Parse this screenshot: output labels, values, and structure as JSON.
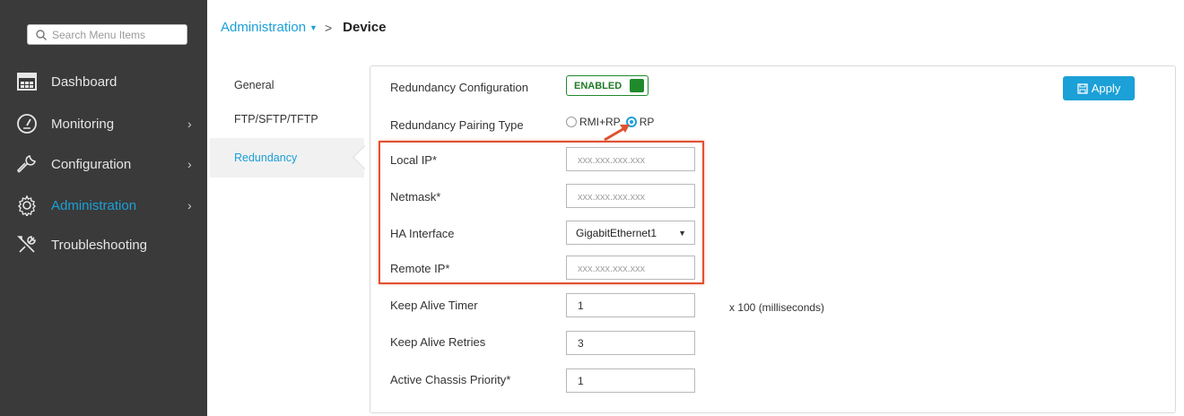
{
  "search": {
    "placeholder": "Search Menu Items"
  },
  "sidebar": {
    "items": [
      {
        "label": "Dashboard",
        "icon": "dashboard-icon",
        "chevron": ""
      },
      {
        "label": "Monitoring",
        "icon": "gauge-icon",
        "chevron": "›"
      },
      {
        "label": "Configuration",
        "icon": "wrench-icon",
        "chevron": "›"
      },
      {
        "label": "Administration",
        "icon": "gear-icon",
        "chevron": "›"
      },
      {
        "label": "Troubleshooting",
        "icon": "tools-icon",
        "chevron": ""
      }
    ]
  },
  "breadcrumb": {
    "parent": "Administration",
    "separator": ">",
    "current": "Device"
  },
  "submenu": {
    "items": [
      "General",
      "FTP/SFTP/TFTP",
      "Redundancy"
    ]
  },
  "form": {
    "redundancy_config_label": "Redundancy Configuration",
    "toggle_label": "ENABLED",
    "pairing_type_label": "Redundancy Pairing Type",
    "radio_rmi_label": "RMI+RP",
    "radio_rp_label": "RP",
    "local_ip_label": "Local IP*",
    "local_ip_placeholder": "xxx.xxx.xxx.xxx",
    "netmask_label": "Netmask*",
    "netmask_placeholder": "xxx.xxx.xxx.xxx",
    "ha_interface_label": "HA Interface",
    "ha_interface_value": "GigabitEthernet1",
    "remote_ip_label": "Remote IP*",
    "remote_ip_placeholder": "xxx.xxx.xxx.xxx",
    "keepalive_timer_label": "Keep Alive Timer",
    "keepalive_timer_value": "1",
    "keepalive_timer_unit": "x 100 (milliseconds)",
    "keepalive_retries_label": "Keep Alive Retries",
    "keepalive_retries_value": "3",
    "chassis_priority_label": "Active Chassis Priority*",
    "chassis_priority_value": "1"
  },
  "apply_label": "Apply",
  "colors": {
    "accent": "#1ba0d7",
    "enabled": "#1f8a2c",
    "highlight": "#e0512f",
    "sidebar": "#3a3a3a"
  }
}
